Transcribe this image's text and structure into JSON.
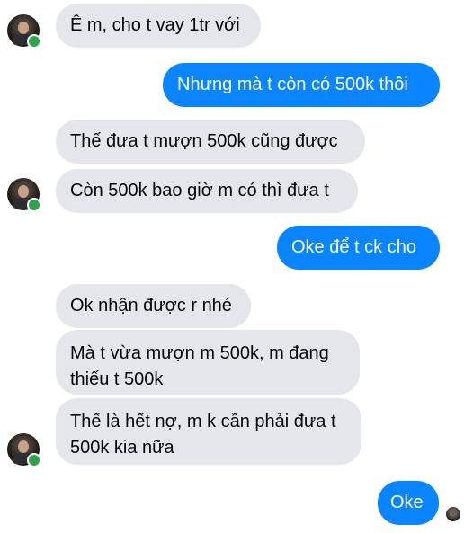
{
  "messages": [
    {
      "side": "in",
      "text": "Ê m, cho t vay 1tr với"
    },
    {
      "side": "out",
      "text": "Nhưng mà t còn có 500k thôi"
    },
    {
      "side": "in",
      "text": "Thế đưa t mượn 500k cũng được"
    },
    {
      "side": "in",
      "text": "Còn 500k bao giờ m có thì đưa t"
    },
    {
      "side": "out",
      "text": "Oke để t ck cho"
    },
    {
      "side": "in",
      "text": "Ok nhận được r nhé"
    },
    {
      "side": "in",
      "text": "Mà t vừa mượn m 500k, m đang thiếu t 500k"
    },
    {
      "side": "in",
      "text": "Thế là hết nợ, m k cần phải đưa t 500k kia nữa"
    },
    {
      "side": "out",
      "text": "Oke"
    }
  ],
  "colors": {
    "incoming_bubble": "#e4e6eb",
    "outgoing_bubble": "#0a84ff",
    "online_dot": "#31a24c"
  },
  "icons": {
    "contact_avatar": "avatar-photo",
    "online_status": "online-dot-icon",
    "seen_receipt": "seen-avatar-icon"
  }
}
